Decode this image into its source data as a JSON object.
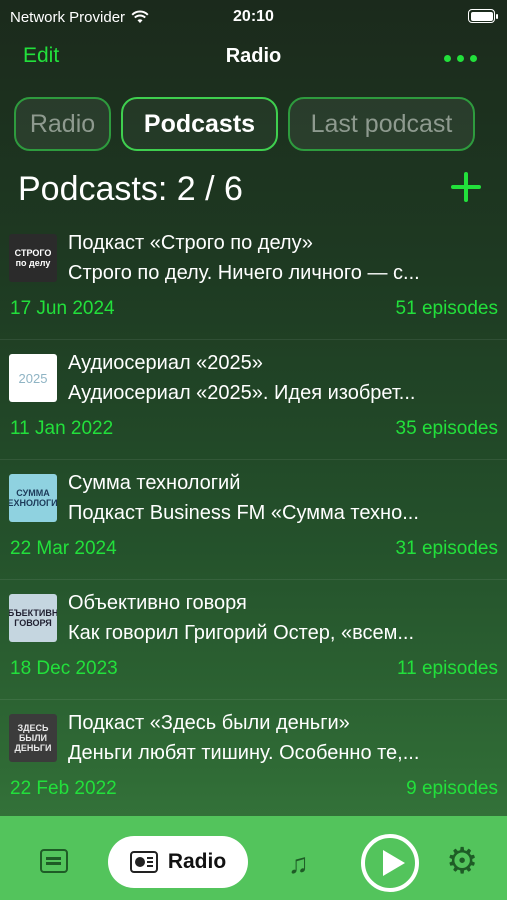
{
  "status_bar": {
    "carrier": "Network Provider",
    "time": "20:10"
  },
  "nav": {
    "edit_label": "Edit",
    "title": "Radio"
  },
  "segments": [
    {
      "label": "Radio",
      "active": false
    },
    {
      "label": "Podcasts",
      "active": true
    },
    {
      "label": "Last podcast",
      "active": false
    }
  ],
  "list_header": {
    "title": "Podcasts: 2 / 6"
  },
  "podcasts": [
    {
      "title": "Подкаст «Строго по делу»",
      "description": "Строго по делу. Ничего личного — с...",
      "date": "17 Jun 2024",
      "episodes": "51 episodes",
      "thumb_text": "СТРОГО по делу"
    },
    {
      "title": "Аудиосериал «2025»",
      "description": "Аудиосериал «2025». Идея изобрет...",
      "date": "11 Jan 2022",
      "episodes": "35 episodes",
      "thumb_text": "2025"
    },
    {
      "title": "Сумма технологий",
      "description": "Подкаст Business FM «Сумма техно...",
      "date": "22 Mar 2024",
      "episodes": "31 episodes",
      "thumb_text": "СУММА ТЕХНОЛОГИЙ"
    },
    {
      "title": "Объективно говоря",
      "description": "Как говорил Григорий Остер, «всем...",
      "date": "18 Dec 2023",
      "episodes": "11 episodes",
      "thumb_text": "ОБЪЕКТИВНО ГОВОРЯ"
    },
    {
      "title": "Подкаст «Здесь были деньги»",
      "description": "Деньги любят тишину. Особенно те,...",
      "date": "22 Feb 2022",
      "episodes": "9 episodes",
      "thumb_text": "ЗДЕСЬ БЫЛИ ДЕНЬГИ"
    }
  ],
  "tab_bar": {
    "radio_label": "Radio"
  },
  "colors": {
    "accent": "#22e03b",
    "tab_bar": "#53c45c"
  }
}
